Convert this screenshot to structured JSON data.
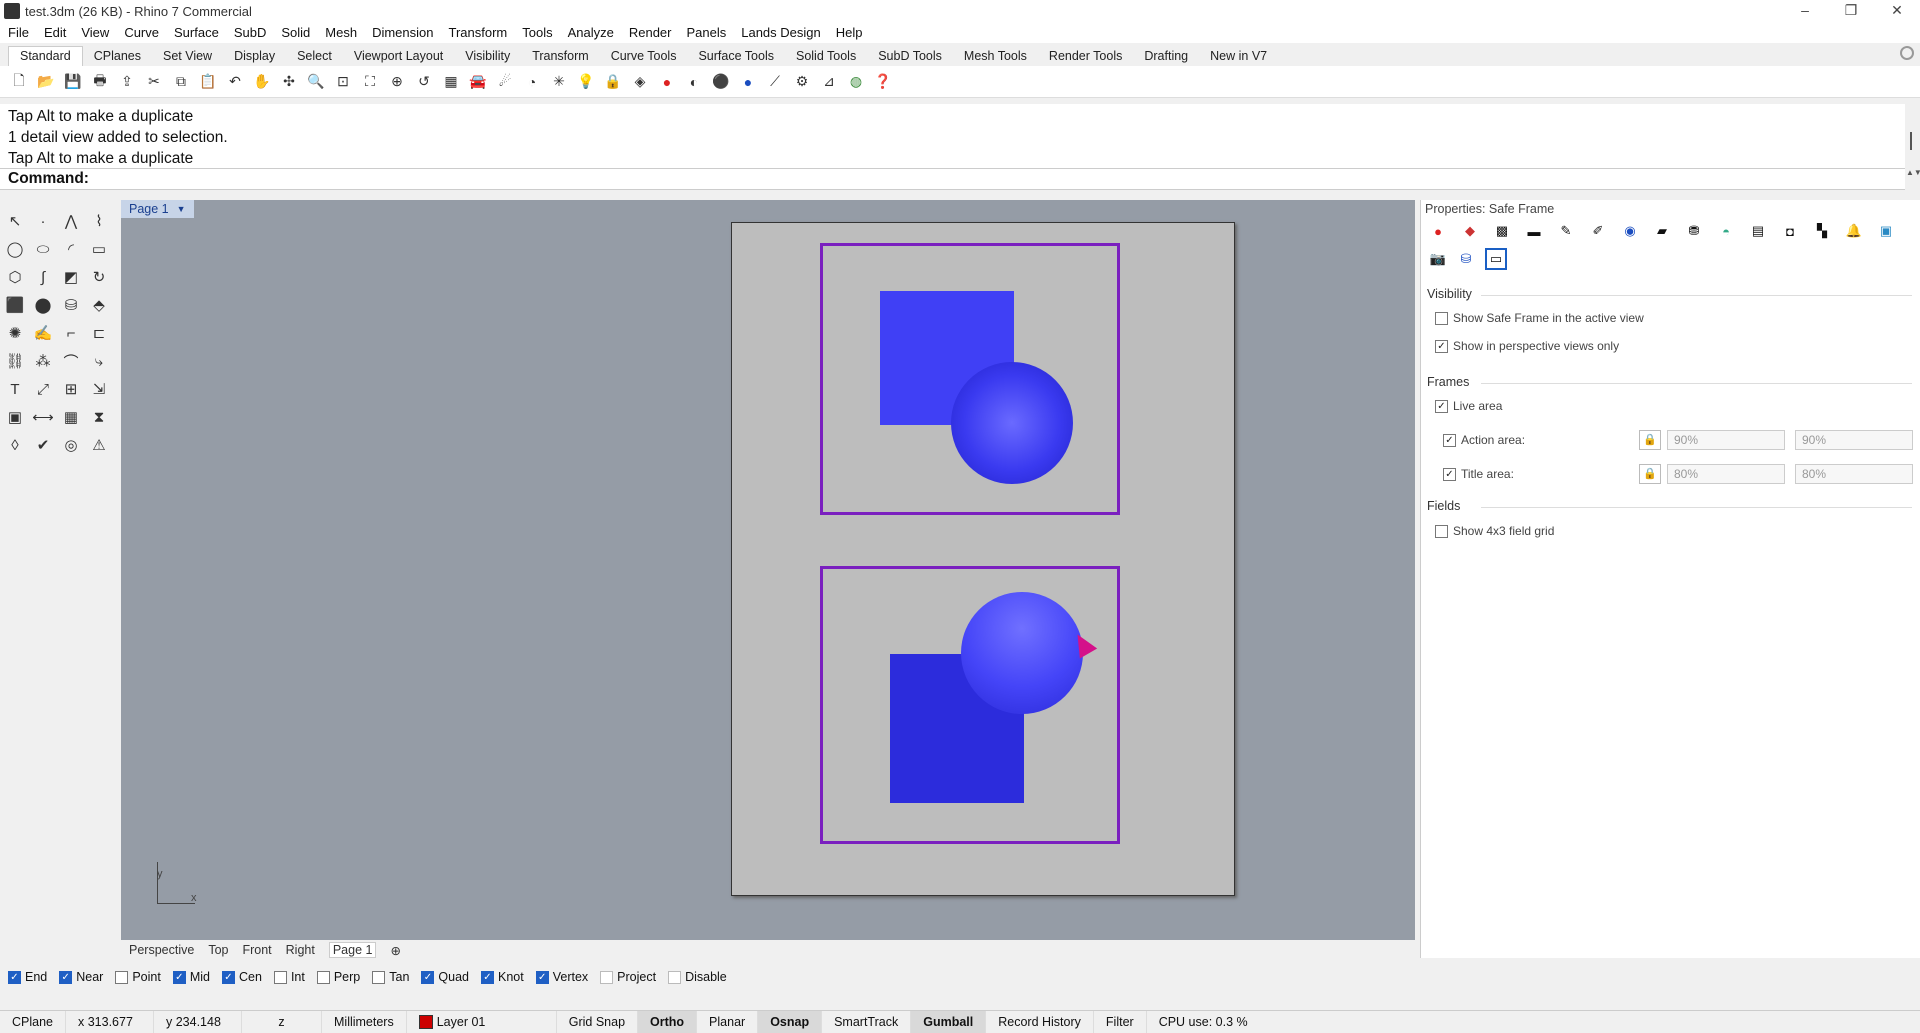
{
  "window": {
    "title": "test.3dm (26 KB) - Rhino 7 Commercial",
    "minimize": "–",
    "restore": "❐",
    "close": "✕"
  },
  "menu": [
    "File",
    "Edit",
    "View",
    "Curve",
    "Surface",
    "SubD",
    "Solid",
    "Mesh",
    "Dimension",
    "Transform",
    "Tools",
    "Analyze",
    "Render",
    "Panels",
    "Lands Design",
    "Help"
  ],
  "tabs": [
    "Standard",
    "CPlanes",
    "Set View",
    "Display",
    "Select",
    "Viewport Layout",
    "Visibility",
    "Transform",
    "Curve Tools",
    "Surface Tools",
    "Solid Tools",
    "SubD Tools",
    "Mesh Tools",
    "Render Tools",
    "Drafting",
    "New in V7"
  ],
  "command": {
    "history": [
      "Tap Alt to make a duplicate",
      "1 detail view added to selection.",
      "Tap Alt to make a duplicate"
    ],
    "prompt": "Command:"
  },
  "page_tab": "Page 1",
  "axes": {
    "y": "y",
    "x": "x"
  },
  "properties": {
    "title": "Properties: Safe Frame",
    "visibility_header": "Visibility",
    "show_safe_frame": {
      "label": "Show Safe Frame in the active view",
      "checked": false
    },
    "show_perspective_only": {
      "label": "Show in perspective views only",
      "checked": true
    },
    "frames_header": "Frames",
    "live_area": {
      "label": "Live area",
      "checked": true
    },
    "action_area": {
      "label": "Action area:",
      "checked": true,
      "v1": "90%",
      "v2": "90%"
    },
    "title_area": {
      "label": "Title area:",
      "checked": true,
      "v1": "80%",
      "v2": "80%"
    },
    "fields_header": "Fields",
    "show_field_grid": {
      "label": "Show 4x3 field grid",
      "checked": false
    }
  },
  "viewtabs": [
    "Perspective",
    "Top",
    "Front",
    "Right",
    "Page 1"
  ],
  "osnaps": [
    {
      "label": "End",
      "on": true
    },
    {
      "label": "Near",
      "on": true
    },
    {
      "label": "Point",
      "on": false
    },
    {
      "label": "Mid",
      "on": true
    },
    {
      "label": "Cen",
      "on": true
    },
    {
      "label": "Int",
      "on": false
    },
    {
      "label": "Perp",
      "on": false
    },
    {
      "label": "Tan",
      "on": false
    },
    {
      "label": "Quad",
      "on": true
    },
    {
      "label": "Knot",
      "on": true
    },
    {
      "label": "Vertex",
      "on": true
    },
    {
      "label": "Project",
      "on": false
    },
    {
      "label": "Disable",
      "on": false
    }
  ],
  "status": {
    "cplane": "CPlane",
    "x": "x 313.677",
    "y": "y 234.148",
    "z": "z",
    "units": "Millimeters",
    "layer": "Layer 01",
    "gridsnap": "Grid Snap",
    "ortho": "Ortho",
    "planar": "Planar",
    "osnap": "Osnap",
    "smarttrack": "SmartTrack",
    "gumball": "Gumball",
    "record": "Record History",
    "filter": "Filter",
    "cpu": "CPU use: 0.3 %"
  }
}
